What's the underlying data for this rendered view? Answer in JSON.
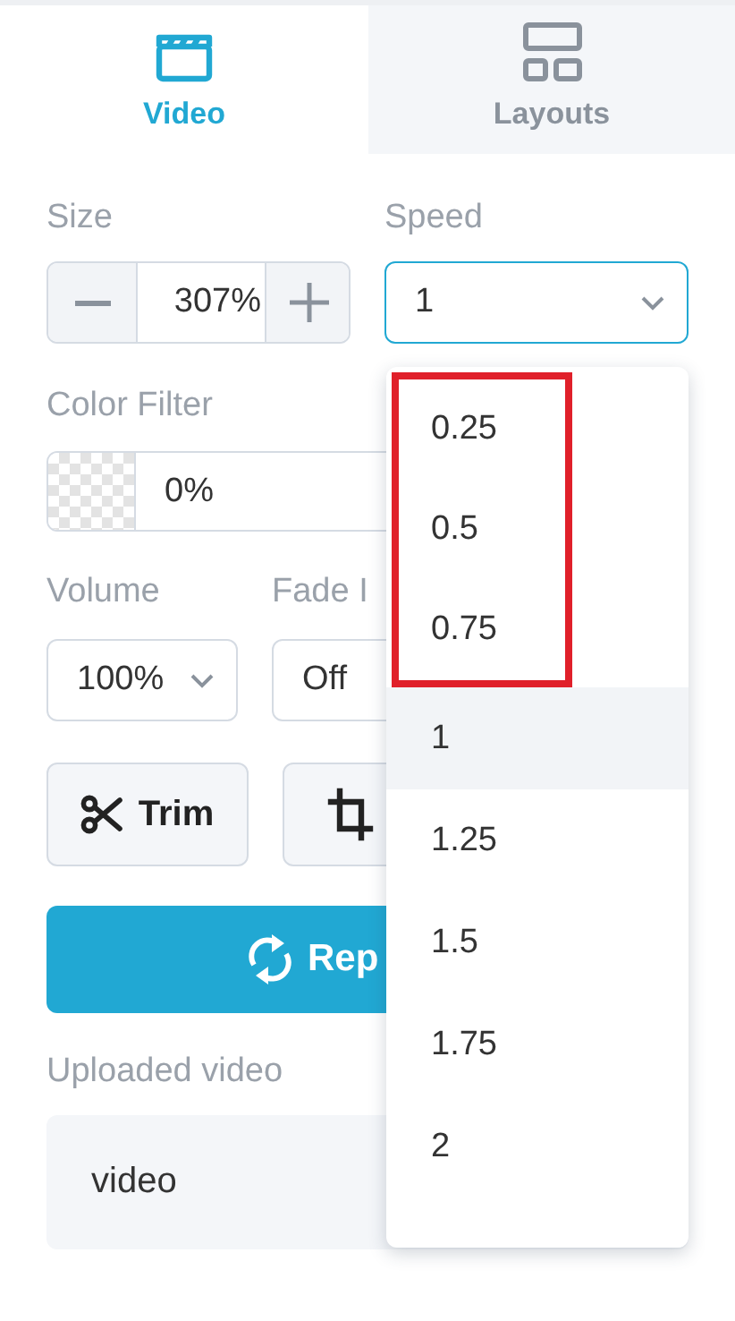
{
  "tabs": [
    {
      "kind": "video",
      "label": "Video",
      "selected": true
    },
    {
      "kind": "layouts",
      "label": "Layouts",
      "selected": false
    }
  ],
  "size": {
    "label": "Size",
    "value": "307%"
  },
  "speed": {
    "label": "Speed",
    "value": "1",
    "expanded": true,
    "options": [
      {
        "label": "0.25",
        "selected": false,
        "marked": true
      },
      {
        "label": "0.5",
        "selected": false,
        "marked": true
      },
      {
        "label": "0.75",
        "selected": false,
        "marked": true
      },
      {
        "label": "1",
        "selected": true,
        "marked": false
      },
      {
        "label": "1.25",
        "selected": false,
        "marked": false
      },
      {
        "label": "1.5",
        "selected": false,
        "marked": false
      },
      {
        "label": "1.75",
        "selected": false,
        "marked": false
      },
      {
        "label": "2",
        "selected": false,
        "marked": false
      }
    ]
  },
  "color_filter": {
    "label": "Color Filter",
    "value": "0%"
  },
  "volume": {
    "label": "Volume",
    "value": "100%"
  },
  "fade_in": {
    "label": "Fade I",
    "value": "Off"
  },
  "buttons": [
    {
      "kind": "trim",
      "label": "Trim"
    },
    {
      "kind": "crop"
    }
  ],
  "replace_button": {
    "label": "Rep"
  },
  "uploaded_video": {
    "label": "Uploaded video",
    "value": "video"
  }
}
